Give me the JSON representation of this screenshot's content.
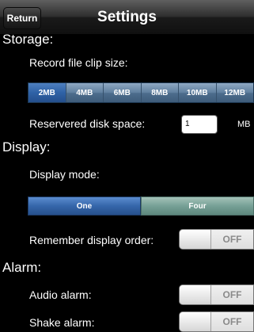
{
  "navbar": {
    "return_label": "Return",
    "title": "Settings"
  },
  "storage": {
    "section_title": "Storage:",
    "clip_label": "Record file clip size:",
    "clip_options": [
      "2MB",
      "4MB",
      "6MB",
      "8MB",
      "10MB",
      "12MB"
    ],
    "clip_selected": "2MB",
    "disk_label": "Reservered disk space:",
    "disk_value": "1",
    "disk_unit": "MB"
  },
  "display": {
    "section_title": "Display:",
    "mode_label": "Display mode:",
    "mode_options": [
      "One",
      "Four"
    ],
    "mode_selected": "One",
    "remember_label": "Remember display order:",
    "remember_state": "OFF"
  },
  "alarm": {
    "section_title": "Alarm:",
    "audio_label": "Audio alarm:",
    "audio_state": "OFF",
    "shake_label": "Shake alarm:",
    "shake_state": "OFF"
  }
}
